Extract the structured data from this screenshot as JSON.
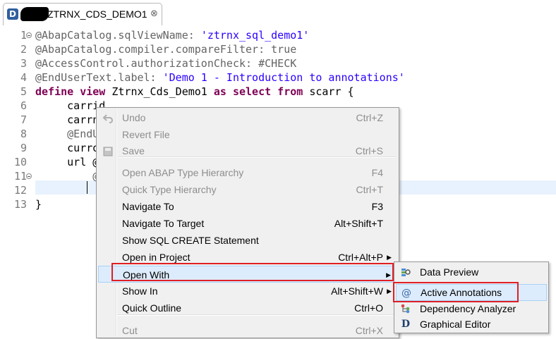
{
  "tab": {
    "title": "ZTRNX_CDS_DEMO1",
    "close_glyph": "⊗",
    "icon_letter": "D",
    "icon": "ddl-source-icon"
  },
  "editor": {
    "lines": [
      {
        "n": "1",
        "parts": [
          {
            "t": "@AbapCatalog.sqlViewName: ",
            "c": "annot"
          },
          {
            "t": "'ztrnx_sql_demo1'",
            "c": "str"
          }
        ]
      },
      {
        "n": "2",
        "parts": [
          {
            "t": "@AbapCatalog.compiler.compareFilter: true",
            "c": "annot"
          }
        ]
      },
      {
        "n": "3",
        "parts": [
          {
            "t": "@AccessControl.authorizationCheck: #CHECK",
            "c": "annot"
          }
        ]
      },
      {
        "n": "4",
        "parts": [
          {
            "t": "@EndUserText.label: ",
            "c": "annot"
          },
          {
            "t": "'Demo 1 - Introduction to annotations'",
            "c": "str"
          }
        ]
      },
      {
        "n": "5",
        "parts": [
          {
            "t": "define view ",
            "c": "kw"
          },
          {
            "t": "Ztrnx_Cds_Demo1 ",
            "c": "plain"
          },
          {
            "t": "as select from ",
            "c": "kw"
          },
          {
            "t": "scarr {",
            "c": "plain"
          }
        ]
      },
      {
        "n": "6",
        "parts": [
          {
            "t": "     carrid,",
            "c": "plain"
          }
        ]
      },
      {
        "n": "7",
        "parts": [
          {
            "t": "     carrn",
            "c": "plain"
          }
        ]
      },
      {
        "n": "8",
        "parts": [
          {
            "t": "     @EndU",
            "c": "annot"
          }
        ]
      },
      {
        "n": "9",
        "parts": [
          {
            "t": "     curro",
            "c": "plain"
          }
        ]
      },
      {
        "n": "10",
        "parts": [
          {
            "t": "     url @",
            "c": "plain"
          }
        ]
      },
      {
        "n": "11",
        "parts": [
          {
            "t": "         @",
            "c": "annot"
          }
        ]
      },
      {
        "n": "12",
        "parts": []
      },
      {
        "n": "13",
        "parts": [
          {
            "t": "}",
            "c": "plain"
          }
        ]
      }
    ]
  },
  "context_menu": {
    "items": [
      {
        "label": "Undo",
        "shortcut": "Ctrl+Z",
        "enabled": false,
        "icon": "undo-icon"
      },
      {
        "label": "Revert File",
        "shortcut": "",
        "enabled": false
      },
      {
        "label": "Save",
        "shortcut": "Ctrl+S",
        "enabled": false,
        "icon": "save-icon"
      },
      {
        "label": "Open ABAP Type Hierarchy",
        "shortcut": "F4",
        "enabled": false
      },
      {
        "label": "Quick Type Hierarchy",
        "shortcut": "Ctrl+T",
        "enabled": false
      },
      {
        "label": "Navigate To",
        "shortcut": "F3",
        "enabled": true
      },
      {
        "label": "Navigate To Target",
        "shortcut": "Alt+Shift+T",
        "enabled": true
      },
      {
        "label": "Show SQL CREATE Statement",
        "shortcut": "",
        "enabled": true
      },
      {
        "label": "Open in Project",
        "shortcut": "Ctrl+Alt+P",
        "enabled": true,
        "submenu": true
      },
      {
        "label": "Open With",
        "shortcut": "",
        "enabled": true,
        "submenu": true,
        "highlighted": true
      },
      {
        "label": "Show In",
        "shortcut": "Alt+Shift+W",
        "enabled": true,
        "submenu": true
      },
      {
        "label": "Quick Outline",
        "shortcut": "Ctrl+O",
        "enabled": true
      },
      {
        "label": "Cut",
        "shortcut": "Ctrl+X",
        "enabled": false
      }
    ]
  },
  "submenu": {
    "items": [
      {
        "label": "Data Preview",
        "icon": "data-preview-icon"
      },
      {
        "label": "Active Annotations",
        "icon": "annotation-at-icon",
        "highlighted": true
      },
      {
        "label": "Dependency Analyzer",
        "icon": "dependency-analyzer-icon"
      },
      {
        "label": "Graphical Editor",
        "icon": "graphical-editor-icon",
        "icon_letter": "D"
      }
    ]
  },
  "colors": {
    "annotation": "#646464",
    "string": "#2a00ff",
    "keyword": "#7f0055",
    "highlight_box": "#e01e26",
    "menu_highlight": "#ddecfc"
  }
}
